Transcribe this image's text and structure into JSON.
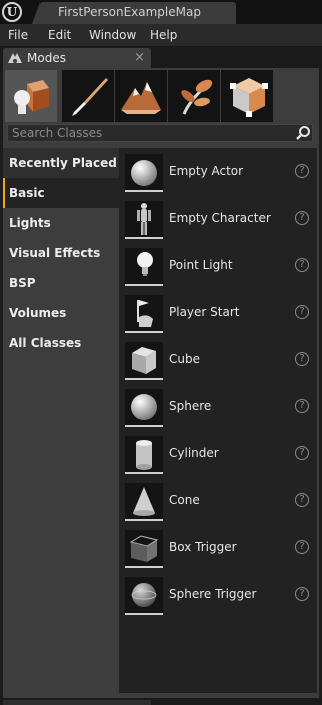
{
  "window": {
    "title": "FirstPersonExampleMap"
  },
  "menu": [
    "File",
    "Edit",
    "Window",
    "Help"
  ],
  "panel": {
    "title": "Modes",
    "close_glyph": "×"
  },
  "mode_tabs": [
    {
      "name": "place-mode",
      "icon": "place-icon",
      "active": true
    },
    {
      "name": "paint-mode",
      "icon": "paint-brush-icon",
      "active": false
    },
    {
      "name": "landscape-mode",
      "icon": "landscape-icon",
      "active": false
    },
    {
      "name": "foliage-mode",
      "icon": "foliage-icon",
      "active": false
    },
    {
      "name": "geometry-mode",
      "icon": "geometry-edit-icon",
      "active": false
    }
  ],
  "search": {
    "placeholder": "Search Classes",
    "value": ""
  },
  "categories": [
    "Recently Placed",
    "Basic",
    "Lights",
    "Visual Effects",
    "BSP",
    "Volumes",
    "All Classes"
  ],
  "selected_category": "Basic",
  "items": [
    {
      "label": "Empty Actor",
      "icon": "sphere-icon"
    },
    {
      "label": "Empty Character",
      "icon": "character-icon"
    },
    {
      "label": "Point Light",
      "icon": "light-bulb-icon"
    },
    {
      "label": "Player Start",
      "icon": "player-start-icon"
    },
    {
      "label": "Cube",
      "icon": "cube-icon"
    },
    {
      "label": "Sphere",
      "icon": "sphere-icon"
    },
    {
      "label": "Cylinder",
      "icon": "cylinder-icon"
    },
    {
      "label": "Cone",
      "icon": "cone-icon"
    },
    {
      "label": "Box Trigger",
      "icon": "box-trigger-icon"
    },
    {
      "label": "Sphere Trigger",
      "icon": "sphere-trigger-icon"
    }
  ],
  "help_glyph": "?",
  "colors": {
    "accent": "#f0a422",
    "panel": "#3d3d3d",
    "list": "#222222"
  }
}
